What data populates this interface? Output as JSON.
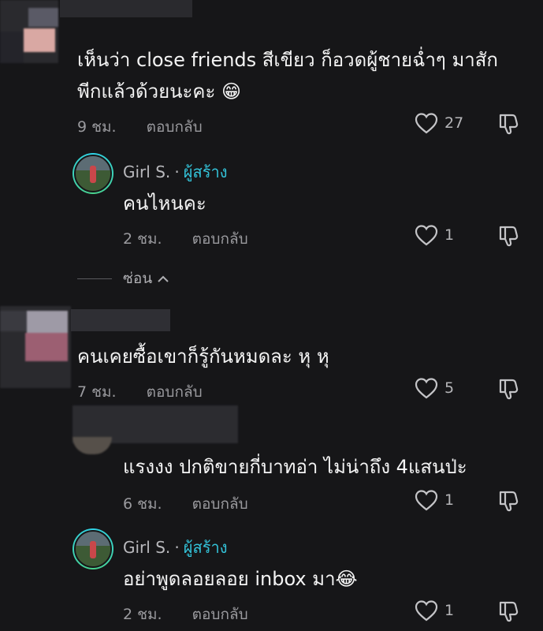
{
  "comments": [
    {
      "text": "เห็นว่า close friends สีเขียว ก็อวดผู้ชายฉ่ำๆ มาสักพีกแล้วด้วยนะคะ 😁",
      "line1": "เห็นว่า close friends สีเขียว ก็อวดผู้ชายฉ่ำๆ มาสัก",
      "line2": "พีกแล้วด้วยนะคะ",
      "emoji": "😁",
      "time": "9 ชม.",
      "reply_label": "ตอบกลับ",
      "likes": "27"
    },
    {
      "author": "Girl S.",
      "dot": "·",
      "badge": "ผู้สร้าง",
      "text": "คนไหนคะ",
      "time": "2 ชม.",
      "reply_label": "ตอบกลับ",
      "likes": "1"
    },
    {
      "hide_label": "ซ่อน",
      "hide_icon": "chevron-up-icon"
    },
    {
      "text": "คนเคยซื้อเขาก็รู้กันหมดละ หุ หุ",
      "time": "7 ชม.",
      "reply_label": "ตอบกลับ",
      "likes": "5"
    },
    {
      "text": "แรงงง ปกติขายกี่บาทอ่า ไม่น่าถึง 4แสนป่ะ",
      "time": "6 ชม.",
      "reply_label": "ตอบกลับ",
      "likes": "1"
    },
    {
      "author": "Girl S.",
      "dot": "·",
      "badge": "ผู้สร้าง",
      "text": "อย่าพูดลอยลอย inbox มา",
      "emoji": "😂",
      "time": "2 ชม.",
      "reply_label": "ตอบกลับ",
      "likes": "1"
    }
  ],
  "colors": {
    "background": "#161618",
    "creator_accent": "#33c3d9",
    "meta_text": "#9a9a9e"
  },
  "icons": {
    "like": "heart-outline-icon",
    "dislike": "thumbs-down-outline-icon"
  }
}
